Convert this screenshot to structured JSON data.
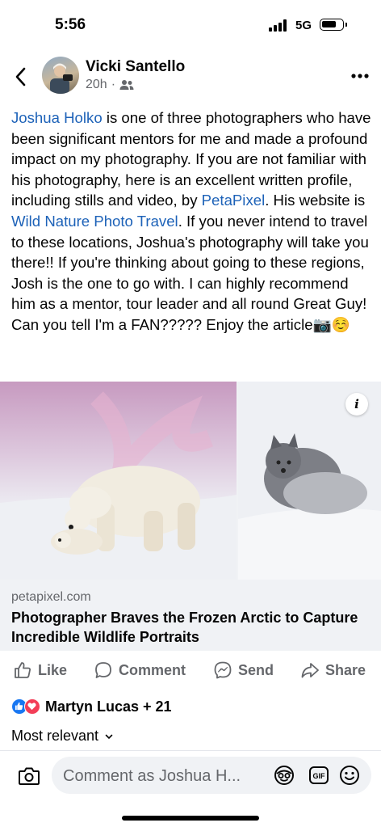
{
  "status_bar": {
    "time": "5:56",
    "network": "5G",
    "battery_level": 0.7
  },
  "header": {
    "author": "Vicki Santello",
    "time_ago": "20h",
    "separator": "·",
    "icons": {
      "back": "back-chevron-icon",
      "audience": "friends-audience-icon",
      "more": "more-options-icon"
    }
  },
  "post": {
    "segments": [
      {
        "text": "Joshua Holko",
        "link": true
      },
      {
        "text": " is one of three photographers who have been significant mentors for me and made a profound impact on my photography. If you are not familiar with his photography, here is an excellent written profile, including stills and video, by ",
        "link": false
      },
      {
        "text": "PetaPixel",
        "link": true
      },
      {
        "text": ". His website is ",
        "link": false
      },
      {
        "text": "Wild Nature Photo Travel",
        "link": true
      },
      {
        "text": ". If you never intend to travel to these locations, Joshua's photography will take you there!! If you're thinking about going to these regions, Josh is the one to go with. I can highly recommend him as a mentor, tour leader and all round Great Guy! Can you tell I'm a FAN????? Enjoy the article📷☺️",
        "link": false
      }
    ],
    "link_color": "#1d62b8"
  },
  "link_card": {
    "domain": "petapixel.com",
    "title": "Photographer Braves the Frozen Arctic to Capture Incredible Wildlife Portraits",
    "info_label": "i",
    "images": [
      "polar-bears-photo",
      "arctic-fox-photo"
    ]
  },
  "actions": {
    "like": "Like",
    "comment": "Comment",
    "send": "Send",
    "share": "Share"
  },
  "reactions": {
    "types": [
      "like",
      "love"
    ],
    "summary": "Martyn Lucas + 21"
  },
  "comments": {
    "sort_label": "Most relevant"
  },
  "comment_bar": {
    "placeholder": "Comment as Joshua H...",
    "icons": [
      "camera-icon",
      "avatar-sticker-icon",
      "gif-icon",
      "emoji-icon"
    ]
  },
  "colors": {
    "accent": "#1877f2",
    "love": "#f33e58",
    "secondary_text": "#65676b"
  }
}
